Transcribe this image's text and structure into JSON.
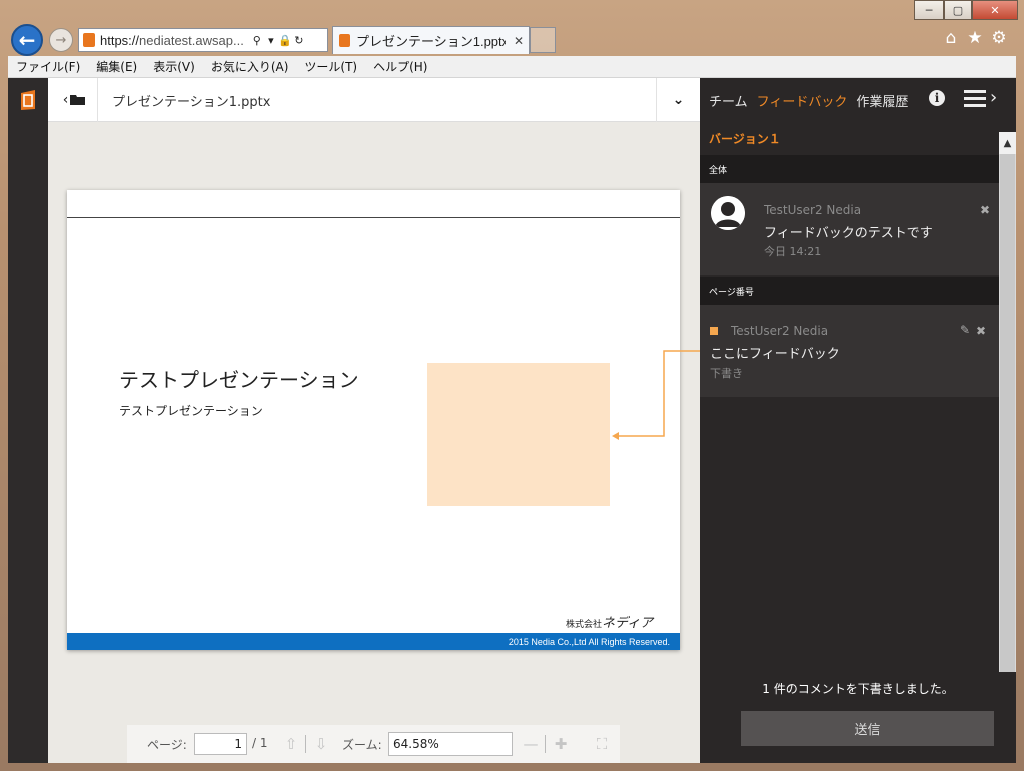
{
  "browser": {
    "address": "https://nediatest.awsap...",
    "address_scheme": "https://",
    "address_host": "nediatest.awsap...",
    "tab_title": "プレゼンテーション1.pptx...",
    "icons": [
      "back-arrow-icon",
      "forward-arrow-icon",
      "search-icon",
      "dropdown-icon",
      "lock-icon",
      "refresh-icon",
      "close-icon",
      "home-icon",
      "favorites-star-icon",
      "settings-gear-icon",
      "minimize-icon",
      "maximize-icon",
      "window-close-icon"
    ]
  },
  "menubar": {
    "items": [
      "ファイル(F)",
      "編集(E)",
      "表示(V)",
      "お気に入り(A)",
      "ツール(T)",
      "ヘルプ(H)"
    ]
  },
  "document": {
    "filename": "プレゼンテーション1.pptx"
  },
  "slide": {
    "title": "テストプレゼンテーション",
    "subtitle": "テストプレゼンテーション",
    "company_prefix": "株式会社",
    "company_name": "ネディア",
    "footer": "2015 Nedia Co.,Ltd All Rights Reserved.",
    "shape_color": "#fde3c6",
    "footer_color": "#0e6fc1"
  },
  "pager": {
    "page_label": "ページ:",
    "page_value": "1",
    "page_total": "/ 1",
    "zoom_label": "ズーム:",
    "zoom_value": "64.58%"
  },
  "panel": {
    "tabs": [
      {
        "label": "チーム",
        "active": false
      },
      {
        "label": "フィードバック",
        "active": true
      },
      {
        "label": "作業履歴",
        "active": false
      }
    ],
    "version": "バージョン１",
    "section_all": "全体",
    "section_page": "ページ番号",
    "comments": [
      {
        "user": "TestUser2 Nedia",
        "text": "フィードバックのテストです",
        "meta": "今日 14:21"
      },
      {
        "user": "TestUser2 Nedia",
        "text": "ここにフィードバック",
        "meta": "下書き"
      }
    ],
    "notice": "1 件のコメントを下書きしました。",
    "send_label": "送信",
    "accent_color": "#f08a27"
  }
}
